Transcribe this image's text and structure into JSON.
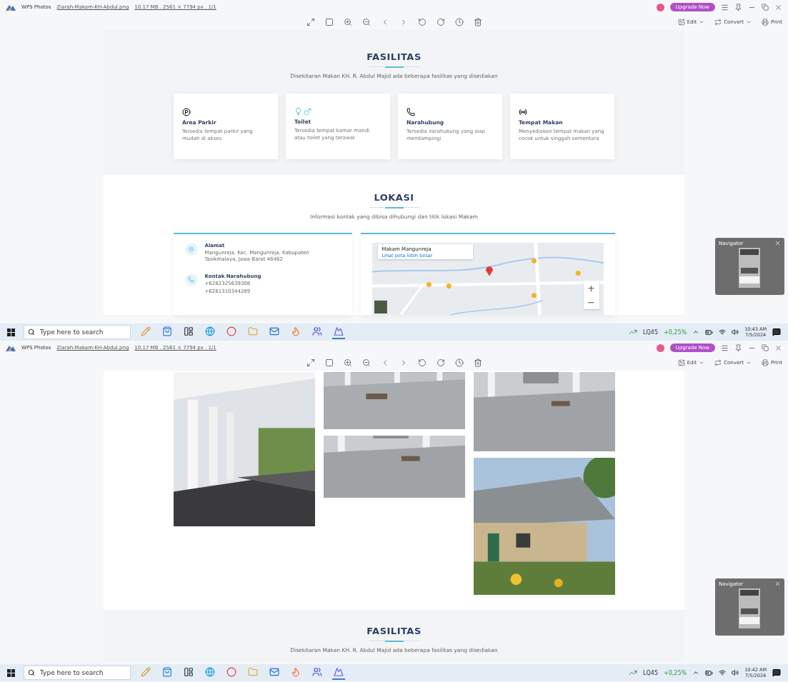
{
  "screens": [
    {
      "window": {
        "app_name": "WPS Photos",
        "file_name": "Ziarah-Makam-KH-Abdul.png",
        "file_info": "10.17 MB . 2561 × 7794 px . 1/1",
        "upgrade_button": "Upgrade Now",
        "toolbar_right": [
          {
            "label": "Edit",
            "kind": "dropdown"
          },
          {
            "label": "Convert",
            "kind": "dropdown"
          },
          {
            "label": "Print",
            "kind": "button"
          }
        ]
      },
      "sections": [
        {
          "kind": "facilities",
          "title": "FASILITAS",
          "subtitle": "Disekitaran Makan KH. R. Abdul Majid ada beberapa fasilitas yang disediakan",
          "cards": [
            {
              "title": "Area Parkir",
              "text": "Tersedia tempat parkir yang mudah di akses"
            },
            {
              "title": "Toilet",
              "text": "Tersedia tempat kamar mandi atau toilet yang terawat"
            },
            {
              "title": "Narahubung",
              "text": "Tersedia narahubung yang siap mendampingi"
            },
            {
              "title": "Tempat Makan",
              "text": "Menyediakan tempat makan yang cocok untuk singgah sementara"
            }
          ]
        },
        {
          "kind": "location",
          "title": "LOKASI",
          "subtitle": "Informasi kontak yang dibisa dihubungi dan titik lokasi Makam",
          "contacts": [
            {
              "title": "Alamat",
              "lines": [
                "Mangunreja, Kec. Mangunreja, Kabupaten Tasikmalaya, Jawa Barat 46462"
              ]
            },
            {
              "title": "Kontak Narahubung",
              "lines": [
                "+6282325639308",
                "+6281310344289"
              ]
            }
          ],
          "map": {
            "place": "Makam Mangunreja",
            "link": "Lihat peta lebih besar",
            "zoom_in": "+",
            "zoom_out": "−"
          }
        }
      ],
      "navigator": {
        "title": "Navigator"
      },
      "taskbar": {
        "search_placeholder": "Type here to search",
        "ticker": "LQ45",
        "change": "+0,25%",
        "time": "10:43 AM",
        "date": "7/5/2024"
      }
    },
    {
      "window": {
        "app_name": "WPS Photos",
        "file_name": "Ziarah-Makam-KH-Abdul.png",
        "file_info": "10.17 MB . 2561 × 7794 px . 1/1",
        "upgrade_button": "Upgrade Now",
        "toolbar_right": [
          {
            "label": "Edit",
            "kind": "dropdown"
          },
          {
            "label": "Convert",
            "kind": "dropdown"
          },
          {
            "label": "Print",
            "kind": "button"
          }
        ]
      },
      "sections": [
        {
          "kind": "gallery"
        },
        {
          "kind": "facilities",
          "title": "FASILITAS",
          "subtitle": "Disekitaran Makan KH. R. Abdul Majid ada beberapa fasilitas yang disediakan"
        }
      ],
      "navigator": {
        "title": "Navigator"
      },
      "taskbar": {
        "search_placeholder": "Type here to search",
        "ticker": "LQ45",
        "change": "+0,25%",
        "time": "10:42 AM",
        "date": "7/5/2024"
      }
    }
  ]
}
